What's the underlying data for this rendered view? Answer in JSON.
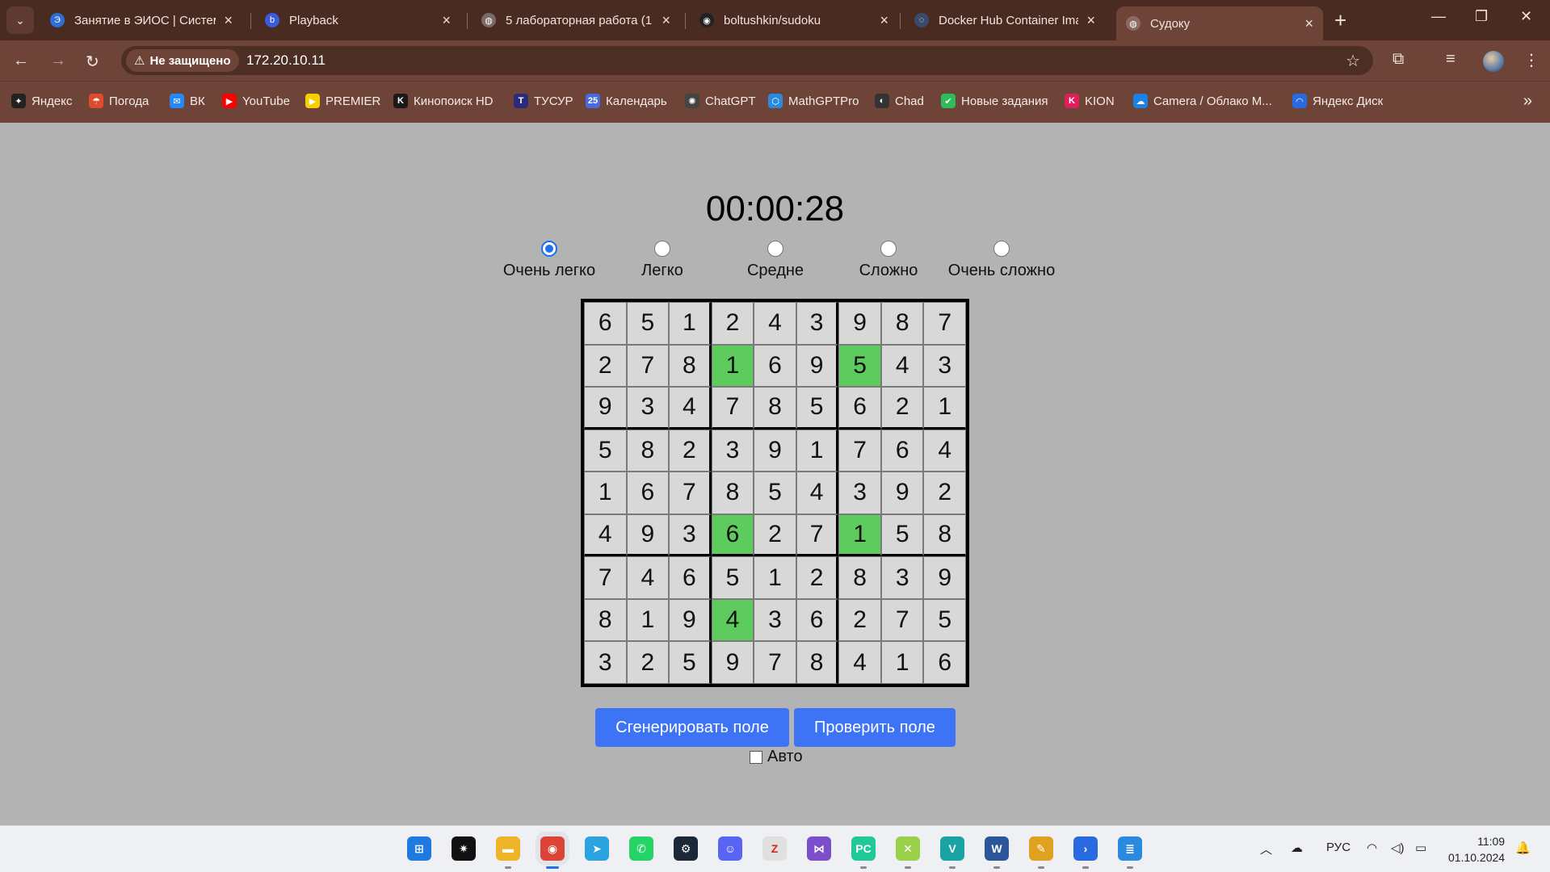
{
  "browser": {
    "tabs": [
      {
        "title": "Занятие в ЭИОС | Система",
        "fav_color": "#2d6fd6",
        "fav_icon": "eios-icon",
        "glyph": "Э"
      },
      {
        "title": "Playback",
        "fav_color": "#3b5bdb",
        "fav_icon": "playback-icon",
        "glyph": "b"
      },
      {
        "title": "5 лабораторная работа (1",
        "fav_color": "#7a6a66",
        "fav_icon": "globe-icon",
        "glyph": "◍"
      },
      {
        "title": "boltushkin/sudoku",
        "fav_color": "#222222",
        "fav_icon": "github-icon",
        "glyph": "◉"
      },
      {
        "title": "Docker Hub Container Ima",
        "fav_color": "#3a4a6a",
        "fav_icon": "docker-icon",
        "glyph": "◌"
      },
      {
        "title": "Судоку",
        "fav_color": "#8a6a66",
        "fav_icon": "globe-icon",
        "glyph": "◍"
      }
    ],
    "address": {
      "security_label": "Не защищено",
      "url": "172.20.10.11"
    },
    "bookmarks": [
      {
        "label": "Яндекс",
        "color": "#222222",
        "glyph": "✦"
      },
      {
        "label": "Погода",
        "color": "#e04a2f",
        "glyph": "☂"
      },
      {
        "label": "ВК",
        "color": "#2787f5",
        "glyph": "✉"
      },
      {
        "label": "YouTube",
        "color": "#ff0000",
        "glyph": "▶"
      },
      {
        "label": "PREMIER",
        "color": "#f5d000",
        "glyph": "▶"
      },
      {
        "label": "Кинопоиск HD",
        "color": "#1a1a1a",
        "glyph": "K"
      },
      {
        "label": "ТУСУР",
        "color": "#2b2b7a",
        "glyph": "T"
      },
      {
        "label": "Календарь",
        "color": "#4a6ae0",
        "glyph": "25"
      },
      {
        "label": "ChatGPT",
        "color": "#444444",
        "glyph": "✺"
      },
      {
        "label": "MathGPTPro",
        "color": "#2a8ae0",
        "glyph": "⬡"
      },
      {
        "label": "Chad",
        "color": "#333333",
        "glyph": "◐"
      },
      {
        "label": "Новые задания",
        "color": "#2ebd59",
        "glyph": "✔"
      },
      {
        "label": "KION",
        "color": "#e01e5a",
        "glyph": "K"
      },
      {
        "label": "Camera / Облако М...",
        "color": "#1a82e0",
        "glyph": "☁"
      },
      {
        "label": "Яндекс Диск",
        "color": "#2a6ae0",
        "glyph": "◠"
      }
    ]
  },
  "page": {
    "timer": "00:00:28",
    "difficulties": [
      {
        "label": "Очень легко",
        "checked": true
      },
      {
        "label": "Легко",
        "checked": false
      },
      {
        "label": "Средне",
        "checked": false
      },
      {
        "label": "Сложно",
        "checked": false
      },
      {
        "label": "Очень сложно",
        "checked": false
      }
    ],
    "board": [
      [
        6,
        5,
        1,
        2,
        4,
        3,
        9,
        8,
        7
      ],
      [
        2,
        7,
        8,
        1,
        6,
        9,
        5,
        4,
        3
      ],
      [
        9,
        3,
        4,
        7,
        8,
        5,
        6,
        2,
        1
      ],
      [
        5,
        8,
        2,
        3,
        9,
        1,
        7,
        6,
        4
      ],
      [
        1,
        6,
        7,
        8,
        5,
        4,
        3,
        9,
        2
      ],
      [
        4,
        9,
        3,
        6,
        2,
        7,
        1,
        5,
        8
      ],
      [
        7,
        4,
        6,
        5,
        1,
        2,
        8,
        3,
        9
      ],
      [
        8,
        1,
        9,
        4,
        3,
        6,
        2,
        7,
        5
      ],
      [
        3,
        2,
        5,
        9,
        7,
        8,
        4,
        1,
        6
      ]
    ],
    "highlighted_cells": [
      [
        1,
        3
      ],
      [
        1,
        6
      ],
      [
        5,
        3
      ],
      [
        5,
        6
      ],
      [
        7,
        3
      ]
    ],
    "highlight_color": "#5ecb5e",
    "generate_label": "Сгенерировать поле",
    "check_label": "Проверить поле",
    "auto_label": "Авто",
    "auto_checked": false,
    "button_color": "#3d74f5"
  },
  "taskbar": {
    "apps": [
      {
        "name": "windows-start-icon",
        "color": "#1f7ae0",
        "glyph": "⊞"
      },
      {
        "name": "spark-app-icon",
        "color": "#111111",
        "glyph": "✷"
      },
      {
        "name": "file-explorer-icon",
        "color": "#f0b429",
        "glyph": "▬"
      },
      {
        "name": "chrome-icon",
        "color": "#db4437",
        "glyph": "◉"
      },
      {
        "name": "telegram-icon",
        "color": "#2aa3df",
        "glyph": "➤"
      },
      {
        "name": "whatsapp-icon",
        "color": "#25d366",
        "glyph": "✆"
      },
      {
        "name": "steam-icon",
        "color": "#1b2838",
        "glyph": "⚙"
      },
      {
        "name": "discord-icon",
        "color": "#5865f2",
        "glyph": "☺"
      },
      {
        "name": "zoom-z-icon",
        "color": "#e0e0e0",
        "glyph": "Z"
      },
      {
        "name": "visual-studio-icon",
        "color": "#7a4fc9",
        "glyph": "⋈"
      },
      {
        "name": "pycharm-icon",
        "color": "#20c997",
        "glyph": "PC"
      },
      {
        "name": "tool-icon",
        "color": "#9ad04a",
        "glyph": "✕"
      },
      {
        "name": "vscode-like-icon",
        "color": "#1aa3a3",
        "glyph": "V"
      },
      {
        "name": "word-icon",
        "color": "#2b579a",
        "glyph": "W"
      },
      {
        "name": "x64dbg-icon",
        "color": "#e0a020",
        "glyph": "✎"
      },
      {
        "name": "powershell-icon",
        "color": "#2a6ae0",
        "glyph": "›"
      },
      {
        "name": "notepad-icon",
        "color": "#2a8ae0",
        "glyph": "≣"
      }
    ],
    "language": "РУС",
    "time": "11:09",
    "date": "01.10.2024"
  }
}
